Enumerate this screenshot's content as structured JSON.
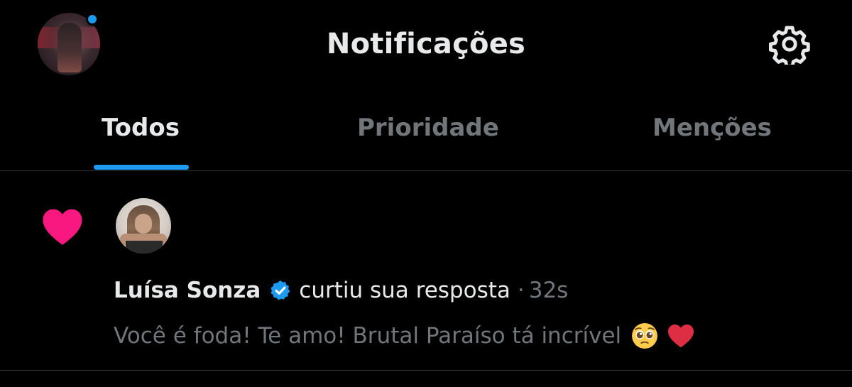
{
  "header": {
    "title": "Notificações",
    "avatar_icon": "profile-avatar",
    "settings_icon": "gear-icon"
  },
  "tabs": [
    {
      "label": "Todos",
      "active": true
    },
    {
      "label": "Prioridade",
      "active": false
    },
    {
      "label": "Menções",
      "active": false
    }
  ],
  "notification": {
    "type_icon": "heart-icon",
    "type_color": "#f91880",
    "user_name": "Luísa Sonza",
    "verified": true,
    "action": "curtiu sua resposta",
    "separator": "·",
    "time": "32s",
    "reply_text": "Você é foda! Te amo! Brutal Paraíso tá incrível",
    "reply_emojis": [
      "pleading-face",
      "red-heart"
    ]
  },
  "colors": {
    "background": "#000000",
    "accent": "#1d9bf0",
    "text_primary": "#e7e9ea",
    "text_secondary": "#71767b",
    "divider": "#2f3336",
    "like": "#f91880"
  }
}
